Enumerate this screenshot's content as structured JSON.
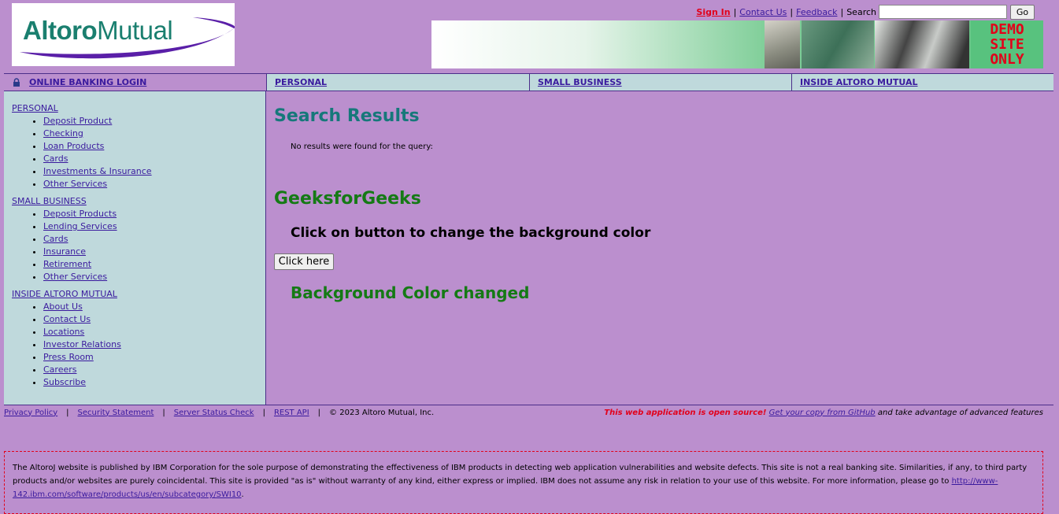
{
  "logo": {
    "part1": "Altoro",
    "part2": "Mutual"
  },
  "top_links": {
    "sign_in": "Sign In",
    "contact_us": "Contact Us",
    "feedback": "Feedback",
    "search_label": "Search",
    "search_value": "",
    "go_label": "Go"
  },
  "banner": {
    "demo_line1": "DEMO",
    "demo_line2": "SITE",
    "demo_line3": "ONLY"
  },
  "nav": {
    "login": "ONLINE BANKING LOGIN",
    "personal": "PERSONAL",
    "small_business": "SMALL BUSINESS",
    "inside": "INSIDE ALTORO MUTUAL"
  },
  "sidebar": {
    "groups": [
      {
        "heading": "PERSONAL",
        "items": [
          "Deposit Product",
          "Checking",
          "Loan Products",
          "Cards",
          "Investments & Insurance",
          "Other Services"
        ]
      },
      {
        "heading": "SMALL BUSINESS",
        "items": [
          "Deposit Products",
          "Lending Services",
          "Cards",
          "Insurance",
          "Retirement",
          "Other Services"
        ]
      },
      {
        "heading": "INSIDE ALTORO MUTUAL",
        "items": [
          "About Us",
          "Contact Us",
          "Locations",
          "Investor Relations",
          "Press Room",
          "Careers",
          "Subscribe"
        ]
      }
    ]
  },
  "main": {
    "results_title": "Search Results",
    "no_results": "No results were found for the query:",
    "gfg_title": "GeeksforGeeks",
    "gfg_subtitle": "Click on button to change the background color",
    "button_label": "Click here",
    "changed_message": "Background Color changed"
  },
  "footer": {
    "privacy": "Privacy Policy",
    "security": "Security Statement",
    "server_status": "Server Status Check",
    "rest_api": "REST API",
    "copyright": "© 2023 Altoro Mutual, Inc.",
    "oss_text": "This web application is open source!",
    "github_link": "Get your copy from GitHub",
    "oss_tail": " and take advantage of advanced features"
  },
  "disclaimer": {
    "text": "The AltoroJ website is published by IBM Corporation for the sole purpose of demonstrating the effectiveness of IBM products in detecting web application vulnerabilities and website defects. This site is not a real banking site. Similarities, if any, to third party products and/or websites are purely coincidental. This site is provided \"as is\" without warranty of any kind, either express or implied. IBM does not assume any risk in relation to your use of this website. For more information, please go to ",
    "link": "http://www-142.ibm.com/software/products/us/en/subcategory/SWI10",
    "tail": "."
  },
  "colors": {
    "background": "#bb8fce",
    "panel": "#bfd9dc",
    "accent_red": "#e2001a",
    "title_teal": "#16787a",
    "gfg_green": "#157a15"
  }
}
